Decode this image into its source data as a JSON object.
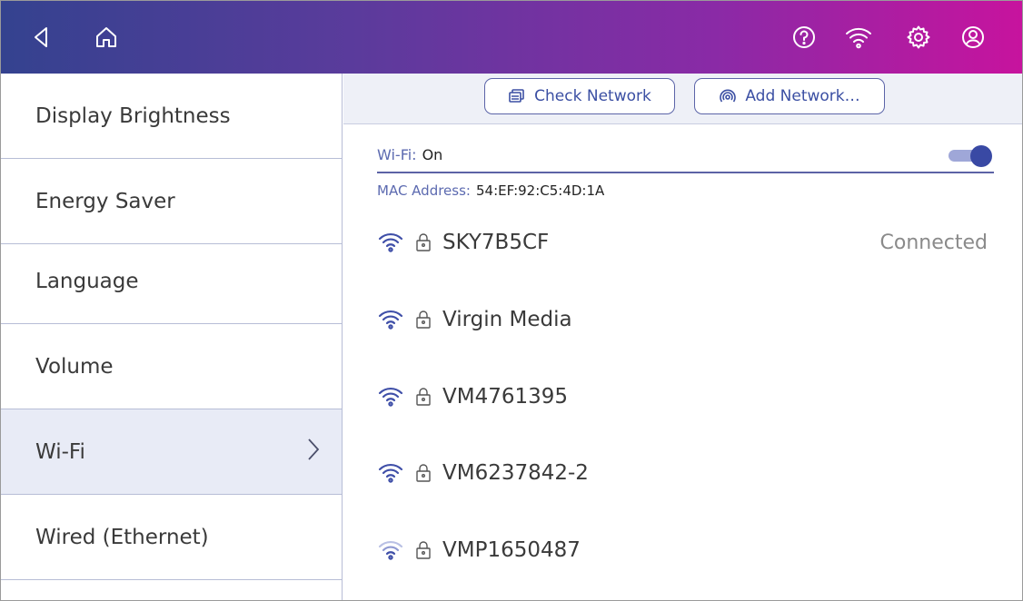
{
  "topbar": {
    "icons": [
      "back-icon",
      "home-icon",
      "help-icon",
      "wifi-icon",
      "settings-icon",
      "account-icon"
    ]
  },
  "sidebar": {
    "items": [
      {
        "label": "Display Brightness",
        "active": false
      },
      {
        "label": "Energy Saver",
        "active": false
      },
      {
        "label": "Language",
        "active": false
      },
      {
        "label": "Volume",
        "active": false
      },
      {
        "label": "Wi-Fi",
        "active": true
      },
      {
        "label": "Wired (Ethernet)",
        "active": false
      }
    ]
  },
  "main": {
    "buttons": {
      "check_network": "Check Network",
      "add_network": "Add Network…"
    },
    "wifi": {
      "label": "Wi-Fi:",
      "value": "On",
      "enabled": true
    },
    "mac": {
      "label": "MAC Address:",
      "value": "54:EF:92:C5:4D:1A"
    },
    "networks": [
      {
        "ssid": "SKY7B5CF",
        "status": "Connected",
        "secured": true,
        "signal": "strong"
      },
      {
        "ssid": "Virgin Media",
        "status": "",
        "secured": true,
        "signal": "strong"
      },
      {
        "ssid": "VM4761395",
        "status": "",
        "secured": true,
        "signal": "strong"
      },
      {
        "ssid": "VM6237842-2",
        "status": "",
        "secured": true,
        "signal": "strong"
      },
      {
        "ssid": "VMP1650487",
        "status": "",
        "secured": true,
        "signal": "weak"
      }
    ]
  },
  "colors": {
    "accent": "#3b4fa3",
    "topbar_start": "#34428f",
    "topbar_end": "#c7139e",
    "active_item": "#e8ebf6"
  }
}
